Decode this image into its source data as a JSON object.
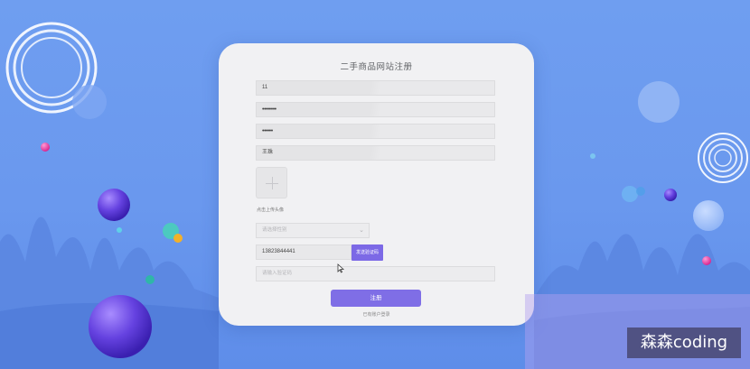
{
  "page": {
    "title": "二手商品网站注册",
    "accent_color": "#7c69e6"
  },
  "form": {
    "username": "11",
    "password_mask": "••••••••",
    "confirm_mask": "••••••",
    "real_name": "王珠",
    "upload_hint": "点击上传头像",
    "select_placeholder": "请选择性别",
    "phone": "13823844441",
    "send_code_label": "发送验证码",
    "code_placeholder": "请输入验证码",
    "submit_label": "注册",
    "login_link": "已有账户登录"
  },
  "icons": {
    "upload": "plus-icon",
    "select": "chevron-down-icon",
    "cursor": "cursor-icon"
  },
  "watermark": {
    "text": "森森coding"
  }
}
